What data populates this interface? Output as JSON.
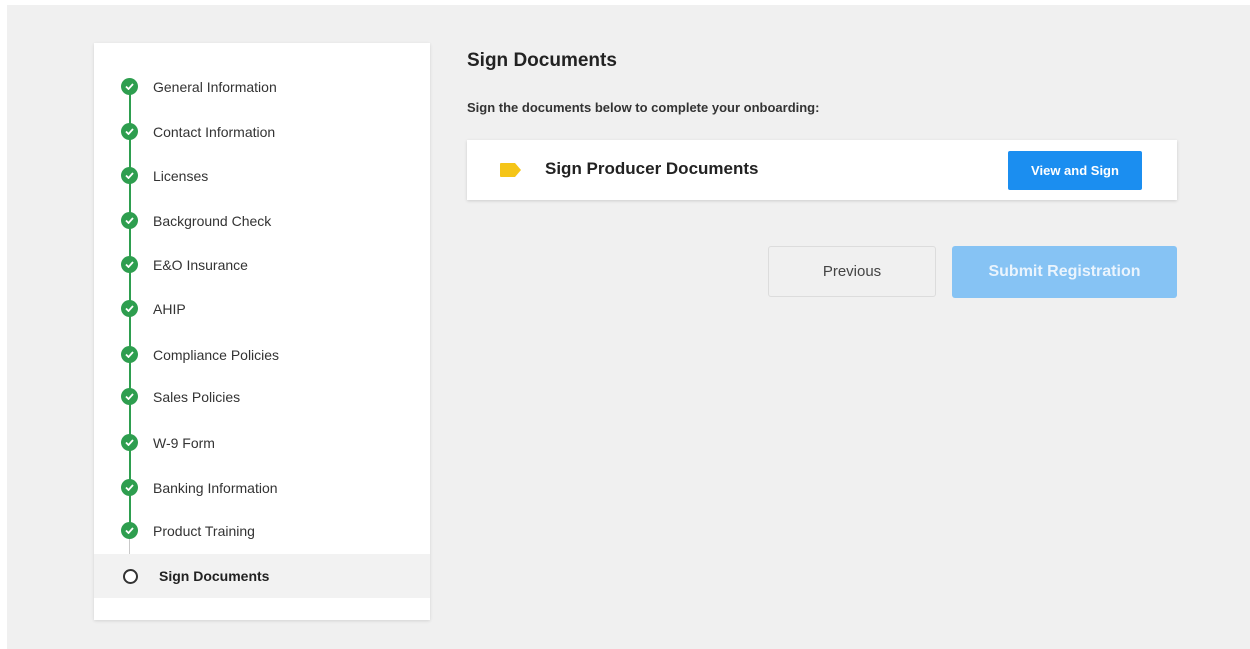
{
  "sidebar": {
    "steps": [
      {
        "label": "General Information",
        "status": "complete"
      },
      {
        "label": "Contact Information",
        "status": "complete"
      },
      {
        "label": "Licenses",
        "status": "complete"
      },
      {
        "label": "Background Check",
        "status": "complete"
      },
      {
        "label": "E&O Insurance",
        "status": "complete"
      },
      {
        "label": "AHIP",
        "status": "complete"
      },
      {
        "label": "Compliance Policies",
        "status": "complete"
      },
      {
        "label": "Sales Policies",
        "status": "complete"
      },
      {
        "label": "W-9 Form",
        "status": "complete"
      },
      {
        "label": "Banking Information",
        "status": "complete"
      },
      {
        "label": "Product Training",
        "status": "complete"
      },
      {
        "label": "Sign Documents",
        "status": "current"
      }
    ]
  },
  "main": {
    "title": "Sign Documents",
    "subtitle": "Sign the documents below to complete your onboarding:",
    "document": {
      "label": "Sign Producer Documents",
      "tag_icon": "tag-icon",
      "tag_color": "#f5c518",
      "action_label": "View and Sign"
    },
    "previous_label": "Previous",
    "submit_label": "Submit Registration",
    "submit_disabled": true
  },
  "colors": {
    "complete": "#2e9e4f",
    "primary": "#1b8ef0",
    "primary_disabled": "#86c3f4",
    "background": "#f0f0f0"
  }
}
